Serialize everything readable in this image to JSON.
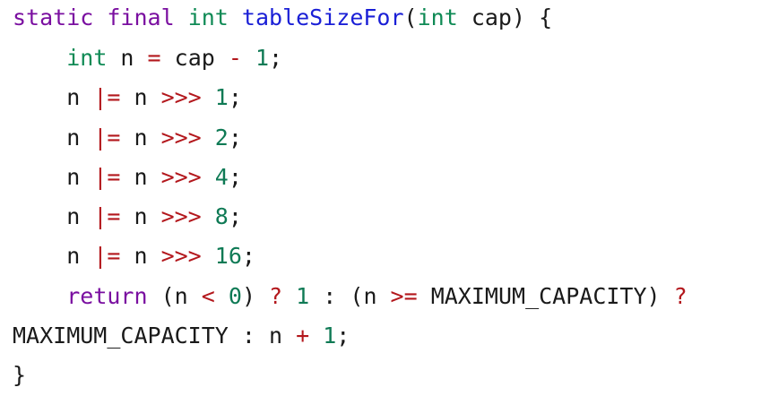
{
  "code": {
    "lines": [
      [
        {
          "text": "static",
          "kind": "kw"
        },
        {
          "text": " ",
          "kind": "plain"
        },
        {
          "text": "final",
          "kind": "kw"
        },
        {
          "text": " ",
          "kind": "plain"
        },
        {
          "text": "int",
          "kind": "ty"
        },
        {
          "text": " ",
          "kind": "plain"
        },
        {
          "text": "tableSizeFor",
          "kind": "fn"
        },
        {
          "text": "(",
          "kind": "plain"
        },
        {
          "text": "int",
          "kind": "ty"
        },
        {
          "text": " cap) {",
          "kind": "plain"
        }
      ],
      [
        {
          "text": "    ",
          "kind": "plain"
        },
        {
          "text": "int",
          "kind": "ty"
        },
        {
          "text": " n ",
          "kind": "plain"
        },
        {
          "text": "=",
          "kind": "op"
        },
        {
          "text": " cap ",
          "kind": "plain"
        },
        {
          "text": "-",
          "kind": "op"
        },
        {
          "text": " ",
          "kind": "plain"
        },
        {
          "text": "1",
          "kind": "num"
        },
        {
          "text": ";",
          "kind": "plain"
        }
      ],
      [
        {
          "text": "    n ",
          "kind": "plain"
        },
        {
          "text": "|=",
          "kind": "op"
        },
        {
          "text": " n ",
          "kind": "plain"
        },
        {
          "text": ">>>",
          "kind": "op"
        },
        {
          "text": " ",
          "kind": "plain"
        },
        {
          "text": "1",
          "kind": "num"
        },
        {
          "text": ";",
          "kind": "plain"
        }
      ],
      [
        {
          "text": "    n ",
          "kind": "plain"
        },
        {
          "text": "|=",
          "kind": "op"
        },
        {
          "text": " n ",
          "kind": "plain"
        },
        {
          "text": ">>>",
          "kind": "op"
        },
        {
          "text": " ",
          "kind": "plain"
        },
        {
          "text": "2",
          "kind": "num"
        },
        {
          "text": ";",
          "kind": "plain"
        }
      ],
      [
        {
          "text": "    n ",
          "kind": "plain"
        },
        {
          "text": "|=",
          "kind": "op"
        },
        {
          "text": " n ",
          "kind": "plain"
        },
        {
          "text": ">>>",
          "kind": "op"
        },
        {
          "text": " ",
          "kind": "plain"
        },
        {
          "text": "4",
          "kind": "num"
        },
        {
          "text": ";",
          "kind": "plain"
        }
      ],
      [
        {
          "text": "    n ",
          "kind": "plain"
        },
        {
          "text": "|=",
          "kind": "op"
        },
        {
          "text": " n ",
          "kind": "plain"
        },
        {
          "text": ">>>",
          "kind": "op"
        },
        {
          "text": " ",
          "kind": "plain"
        },
        {
          "text": "8",
          "kind": "num"
        },
        {
          "text": ";",
          "kind": "plain"
        }
      ],
      [
        {
          "text": "    n ",
          "kind": "plain"
        },
        {
          "text": "|=",
          "kind": "op"
        },
        {
          "text": " n ",
          "kind": "plain"
        },
        {
          "text": ">>>",
          "kind": "op"
        },
        {
          "text": " ",
          "kind": "plain"
        },
        {
          "text": "16",
          "kind": "num"
        },
        {
          "text": ";",
          "kind": "plain"
        }
      ],
      [
        {
          "text": "    ",
          "kind": "plain"
        },
        {
          "text": "return",
          "kind": "kw"
        },
        {
          "text": " (n ",
          "kind": "plain"
        },
        {
          "text": "<",
          "kind": "op"
        },
        {
          "text": " ",
          "kind": "plain"
        },
        {
          "text": "0",
          "kind": "num"
        },
        {
          "text": ") ",
          "kind": "plain"
        },
        {
          "text": "?",
          "kind": "op"
        },
        {
          "text": " ",
          "kind": "plain"
        },
        {
          "text": "1",
          "kind": "num"
        },
        {
          "text": " : (n ",
          "kind": "plain"
        },
        {
          "text": ">=",
          "kind": "op"
        },
        {
          "text": " MAXIMUM_CAPACITY) ",
          "kind": "plain"
        },
        {
          "text": "?",
          "kind": "op"
        }
      ],
      [
        {
          "text": "MAXIMUM_CAPACITY : n ",
          "kind": "plain"
        },
        {
          "text": "+",
          "kind": "op"
        },
        {
          "text": " ",
          "kind": "plain"
        },
        {
          "text": "1",
          "kind": "num"
        },
        {
          "text": ";",
          "kind": "plain"
        }
      ],
      [
        {
          "text": "}",
          "kind": "plain"
        }
      ]
    ]
  },
  "colors": {
    "keyword": "#7a0fa0",
    "type": "#0f8a55",
    "function": "#1a1fd6",
    "operator": "#b3171c",
    "number": "#0f7a55",
    "text": "#1a1a1a",
    "background": "#ffffff"
  }
}
